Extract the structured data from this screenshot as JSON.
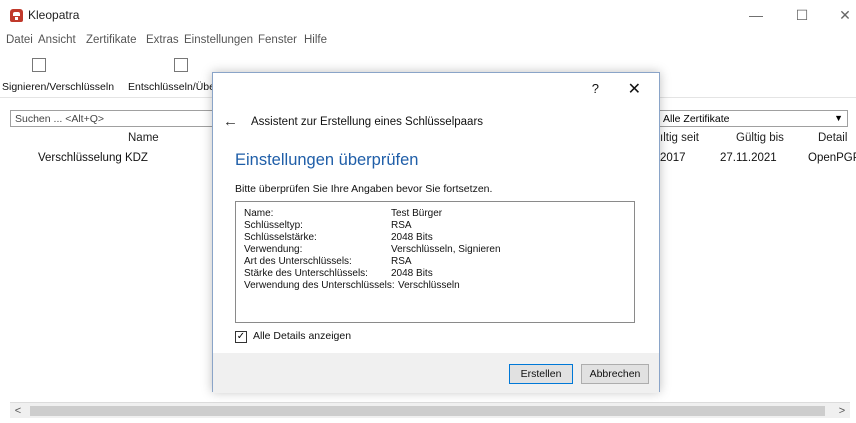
{
  "app": {
    "title": "Kleopatra"
  },
  "menu": [
    "Datei",
    "Ansicht",
    "Zertifikate",
    "Extras",
    "Einstellungen",
    "Fenster",
    "Hilfe"
  ],
  "toolbar": {
    "sign_encrypt": "Signieren/Verschlüsseln",
    "decrypt_verify": "Entschlüsseln/Überp"
  },
  "search": {
    "placeholder": "Suchen ... <Alt+Q>"
  },
  "filter": {
    "value": "Alle Zertifikate"
  },
  "table": {
    "headers": {
      "name": "Name",
      "valid_from": "ıltig seit",
      "valid_until": "Gültig bis",
      "details": "Detail"
    },
    "rows": [
      {
        "name": "Verschlüsselung KDZ",
        "valid_from": "2017",
        "valid_until": "27.11.2021",
        "details": "OpenPGP"
      }
    ]
  },
  "dialog": {
    "help": "?",
    "close": "✕",
    "title": "Assistent zur Erstellung eines Schlüsselpaars",
    "heading": "Einstellungen überprüfen",
    "intro": "Bitte überprüfen Sie Ihre Angaben bevor Sie fortsetzen.",
    "details": [
      {
        "key": "Name:",
        "value": "Test Bürger"
      },
      {
        "key": "Schlüsseltyp:",
        "value": "RSA"
      },
      {
        "key": "Schlüsselstärke:",
        "value": "2048 Bits"
      },
      {
        "key": "Verwendung:",
        "value": "Verschlüsseln, Signieren"
      },
      {
        "key": "Art des Unterschlüssels:",
        "value": "RSA"
      },
      {
        "key": "Stärke des Unterschlüssels:",
        "value": "2048 Bits"
      },
      {
        "key": "Verwendung des Unterschlüssels:",
        "value": "Verschlüsseln"
      }
    ],
    "show_all_details": {
      "label": "Alle Details anzeigen",
      "checked": true
    },
    "buttons": {
      "create": "Erstellen",
      "cancel": "Abbrechen"
    }
  }
}
